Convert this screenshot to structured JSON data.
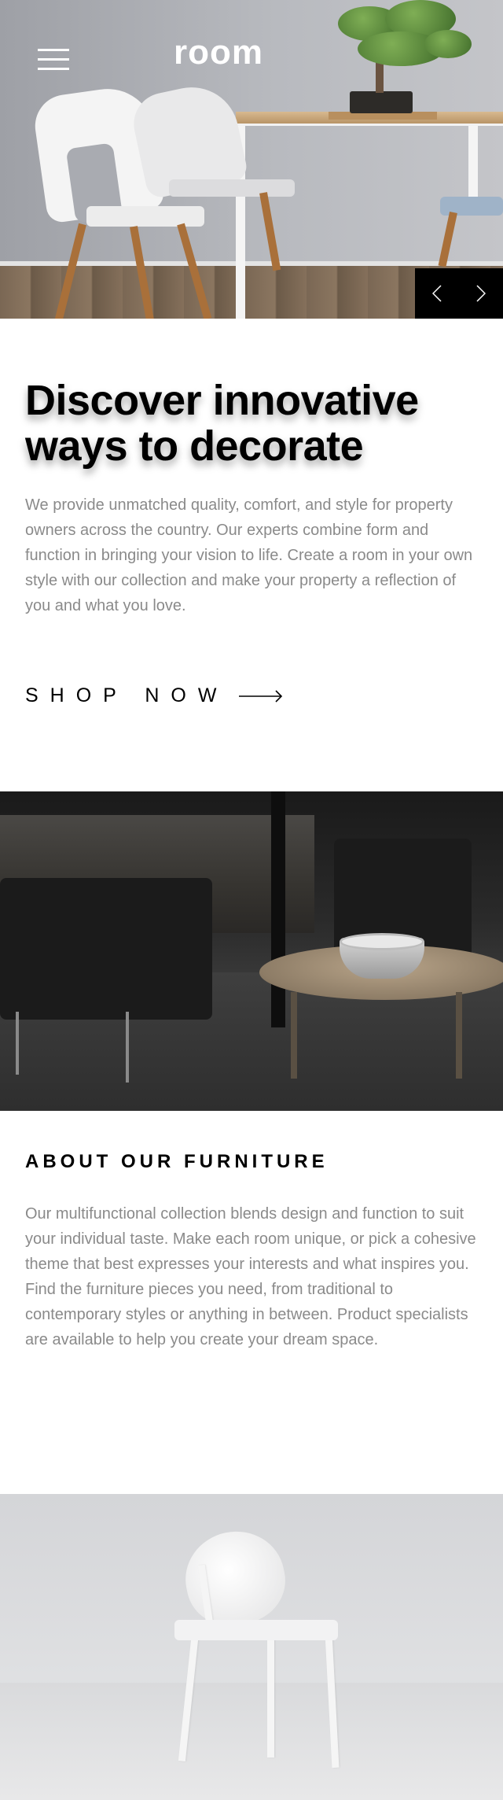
{
  "header": {
    "logo": "room",
    "menu_icon": "hamburger-menu-icon"
  },
  "slider": {
    "prev_icon": "chevron-left-icon",
    "next_icon": "chevron-right-icon"
  },
  "intro": {
    "title": "Discover innovative ways to decorate",
    "body": "We provide unmatched quality, comfort, and style for property owners across the country. Our experts combine form and function in bringing your vision to life. Create a room in your own style with our collection and make your property a reflection of you and what you love.",
    "cta_label": "SHOP NOW",
    "cta_icon": "arrow-right-icon"
  },
  "about": {
    "title": "ABOUT OUR FURNITURE",
    "body": "Our multifunctional collection blends design and function to suit your individual taste. Make each room unique, or pick a cohesive theme that best expresses your interests and what inspires you. Find the furniture pieces you need, from traditional to contemporary styles or anything in between. Product specialists are available to help you create your dream space."
  },
  "colors": {
    "text_primary": "#000000",
    "text_secondary": "#8a8a8a",
    "nav_background": "#000000",
    "logo_color": "#ffffff"
  }
}
